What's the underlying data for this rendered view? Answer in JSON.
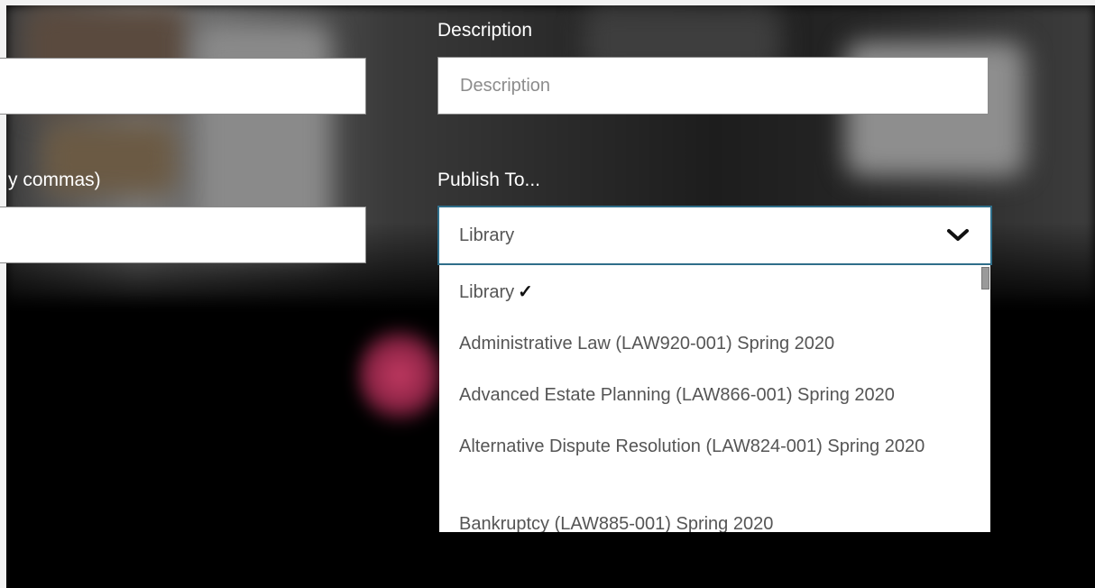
{
  "form": {
    "description_label": "Description",
    "description_placeholder": "Description",
    "tags_label_partial": "y commas)",
    "publish_label": "Publish To...",
    "publish_selected": "Library",
    "check_glyph": "✓",
    "publish_options": [
      "Library",
      "Administrative Law (LAW920-001) Spring 2020",
      "Advanced Estate Planning (LAW866-001) Spring 2020",
      "Alternative Dispute Resolution (LAW824-001) Spring 2020",
      "Bankruptcy (LAW885-001) Spring 2020"
    ]
  },
  "icons": {
    "dropdown_toggle": "chevron-down-icon",
    "selected_marker": "check-icon"
  },
  "colors": {
    "select_focus_border": "#2f6e8a",
    "background": "#000000",
    "glow_accent": "#c23a62"
  }
}
